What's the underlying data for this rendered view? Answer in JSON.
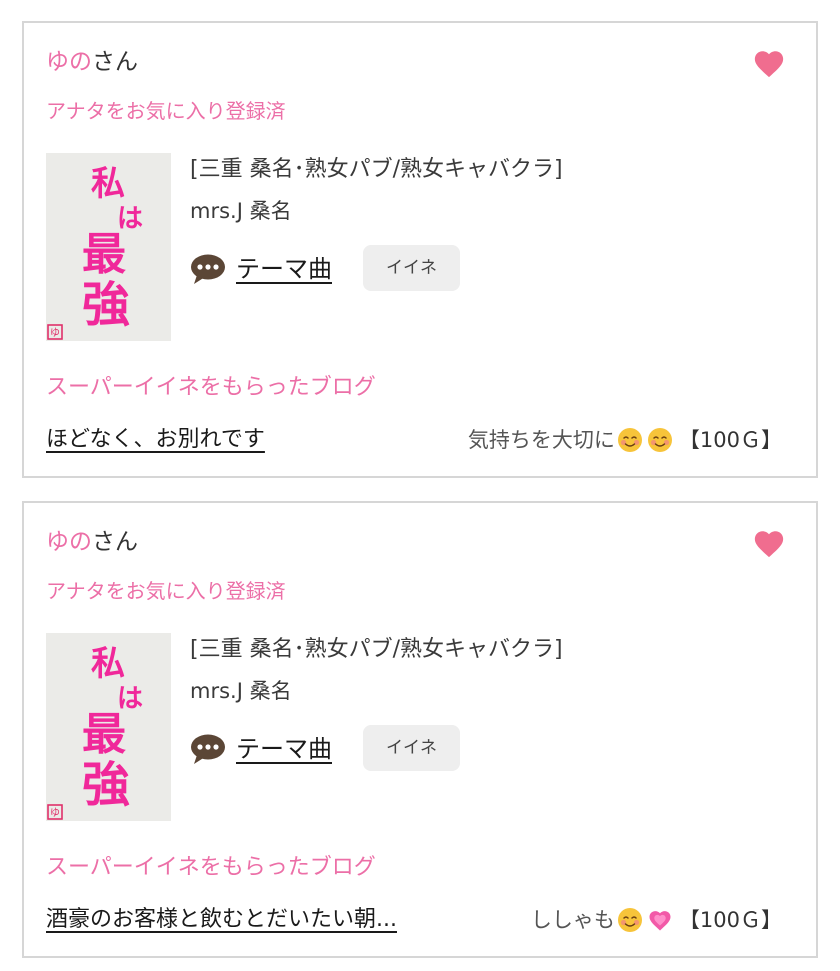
{
  "cards": [
    {
      "user_name": "ゆの",
      "user_suffix": "さん",
      "favorite_status": "アナタをお気に入り登録済",
      "shop_category": "[三重 桑名･熟女パブ/熟女キャバクラ]",
      "shop_name": "mrs.J 桑名",
      "theme_label": "テーマ曲",
      "like_label": "イイネ",
      "super_like_title": "スーパーイイネをもらったブログ",
      "blog_title": "ほどなく、お別れです",
      "comment_text": "気持ちを大切に",
      "comment_emojis": [
        "smiling-face-icon",
        "smiling-face-icon"
      ],
      "comment_points": "【100Ｇ】"
    },
    {
      "user_name": "ゆの",
      "user_suffix": "さん",
      "favorite_status": "アナタをお気に入り登録済",
      "shop_category": "[三重 桑名･熟女パブ/熟女キャバクラ]",
      "shop_name": "mrs.J 桑名",
      "theme_label": "テーマ曲",
      "like_label": "イイネ",
      "super_like_title": "スーパーイイネをもらったブログ",
      "blog_title": "酒豪のお客様と飲むとだいたい朝...",
      "comment_text": "ししゃも",
      "comment_emojis": [
        "smiling-face-icon",
        "growing-heart-icon"
      ],
      "comment_points": "【100Ｇ】"
    }
  ],
  "thumbnail": {
    "calligraphy_lines": [
      "私",
      "は",
      "最",
      "強"
    ],
    "seal_text": "ゆ",
    "ink_color": "#f0289a",
    "background_color": "#ebebe8"
  },
  "colors": {
    "accent_pink": "#ec6fa7",
    "heart": "#f06d8f",
    "chat_icon": "#5b4636",
    "like_button_bg": "#eeeeee",
    "card_border": "#d6d6d6"
  }
}
